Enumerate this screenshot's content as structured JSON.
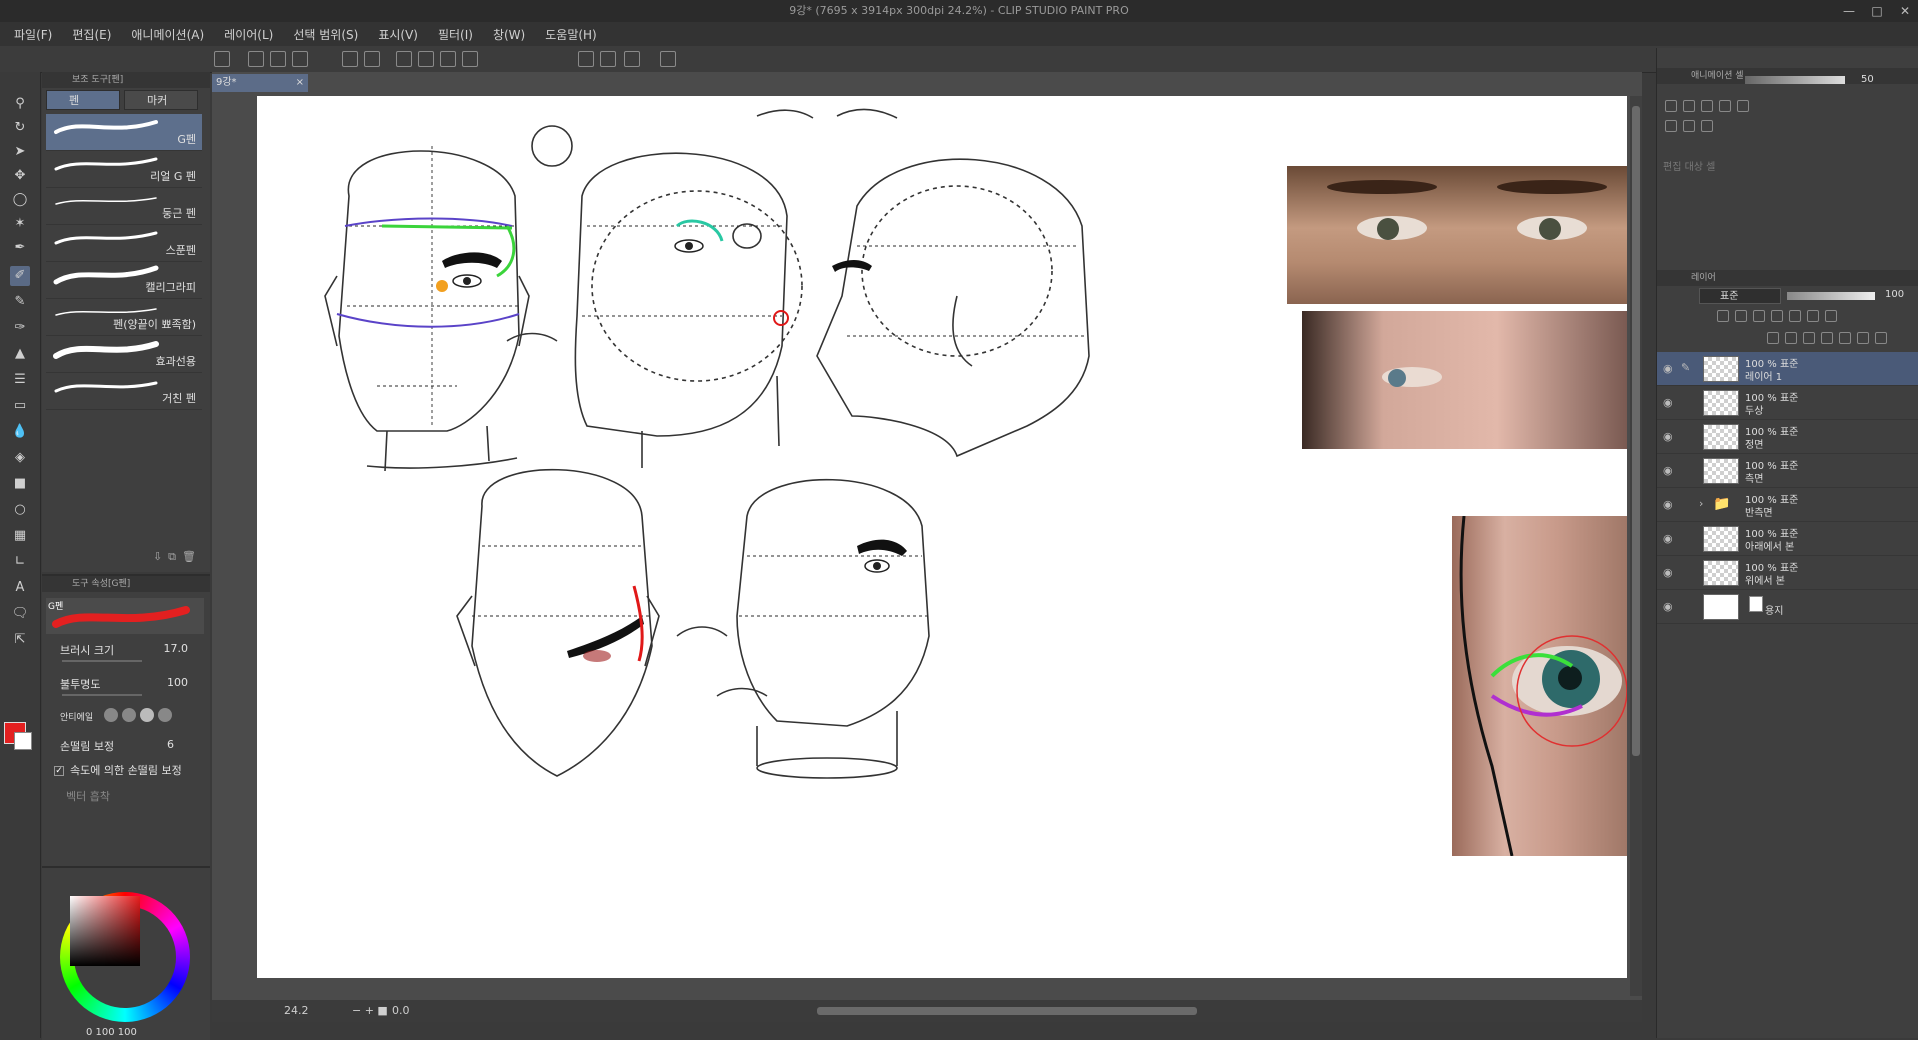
{
  "window": {
    "title": "9강* (7695 x 3914px 300dpi 24.2%)  - CLIP STUDIO PAINT PRO"
  },
  "menu": [
    "파일(F)",
    "편집(E)",
    "애니메이션(A)",
    "레이어(L)",
    "선택 범위(S)",
    "표시(V)",
    "필터(I)",
    "창(W)",
    "도움말(H)"
  ],
  "subtool_panel": {
    "header": "보조 도구[펜]",
    "tabs": [
      "펜",
      "마커"
    ],
    "brushes": [
      "G펜",
      "리얼 G 펜",
      "둥근 펜",
      "스푼펜",
      "캘리그라피",
      "펜(양끝이 뾰족함)",
      "효과선용",
      "거친 펜"
    ]
  },
  "tool_property": {
    "header": "도구 속성[G펜]",
    "preview_label": "G펜",
    "brush_size_label": "브러시 크기",
    "brush_size_value": "17.0",
    "opacity_label": "불투명도",
    "opacity_value": "100",
    "antialias_label": "안티에일",
    "stabilization_label": "손떨림 보정",
    "stabilization_value": "6",
    "speed_stabilization_label": "속도에 의한 손떨림 보정",
    "vector_label": "벡터 흡착"
  },
  "color": {
    "fg": "#e32020",
    "bg": "#ffffff",
    "readout": "0  100  100"
  },
  "document": {
    "tab": "9강*"
  },
  "status": {
    "zoom": "24.2",
    "angle": "0.0"
  },
  "animation_panel": {
    "header": "애니메이션 셀",
    "opacity": "50",
    "target_cell_label": "편집 대상 셀"
  },
  "layer_panel": {
    "header": "레이어",
    "blend_mode": "표준",
    "opacity": "100",
    "layers": [
      {
        "line1": "100 % 표준",
        "line2": "레이어 1",
        "active": true,
        "thumb": "transparent"
      },
      {
        "line1": "100 % 표준",
        "line2": "두상",
        "active": false,
        "thumb": "transparent"
      },
      {
        "line1": "100 % 표준",
        "line2": "정면",
        "active": false,
        "thumb": "transparent"
      },
      {
        "line1": "100 % 표준",
        "line2": "측면",
        "active": false,
        "thumb": "transparent"
      },
      {
        "line1": "100 % 표준",
        "line2": "반측면",
        "active": false,
        "thumb": "folder"
      },
      {
        "line1": "100 % 표준",
        "line2": "아래에서 본",
        "active": false,
        "thumb": "transparent"
      },
      {
        "line1": "100 % 표준",
        "line2": "위에서 본",
        "active": false,
        "thumb": "transparent"
      },
      {
        "line1": "",
        "line2": "용지",
        "active": false,
        "thumb": "white"
      }
    ]
  }
}
